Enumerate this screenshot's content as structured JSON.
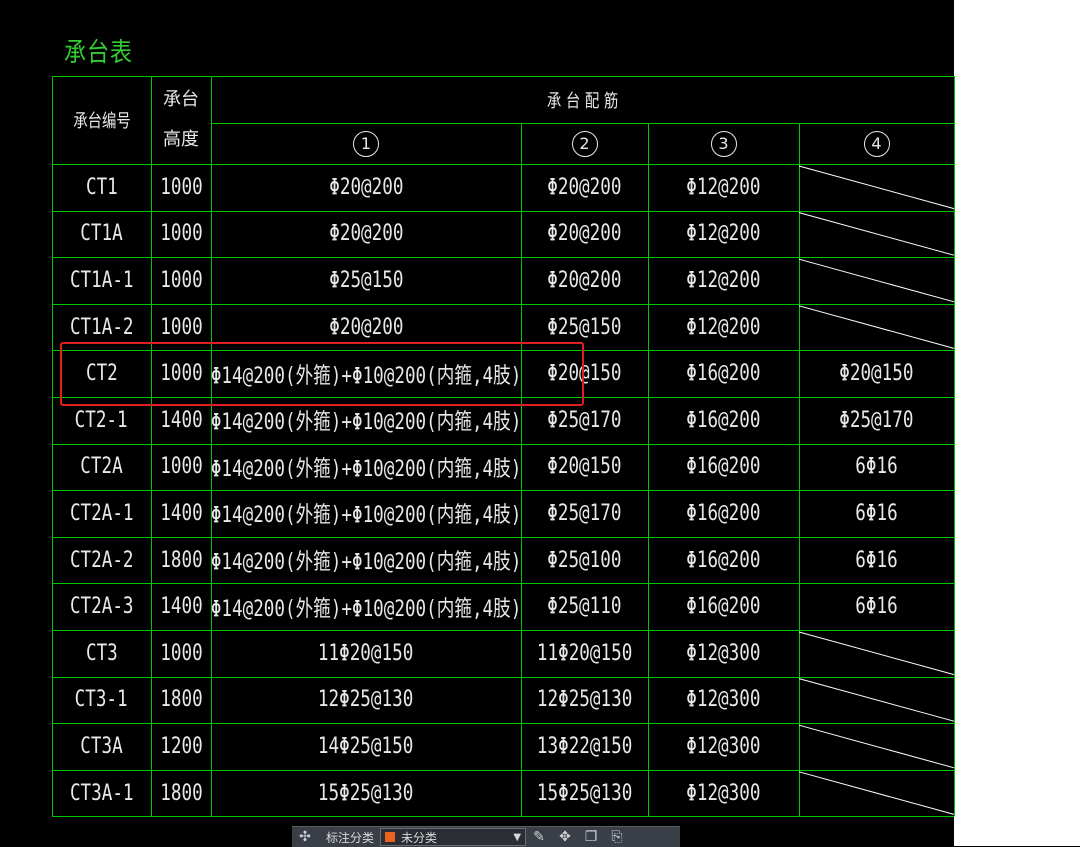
{
  "title": "承台表",
  "headers": {
    "id": "承台编号",
    "height_top": "承台",
    "height_bottom": "高度",
    "rebar": "承 台 配 筋",
    "cols": [
      "1",
      "2",
      "3",
      "4"
    ]
  },
  "rows": [
    {
      "id": "CT1",
      "h": "1000",
      "c1": "Φ20@200",
      "c2": "Φ20@200",
      "c3": "Φ12@200",
      "c4": ""
    },
    {
      "id": "CT1A",
      "h": "1000",
      "c1": "Φ20@200",
      "c2": "Φ20@200",
      "c3": "Φ12@200",
      "c4": ""
    },
    {
      "id": "CT1A-1",
      "h": "1000",
      "c1": "Φ25@150",
      "c2": "Φ20@200",
      "c3": "Φ12@200",
      "c4": ""
    },
    {
      "id": "CT1A-2",
      "h": "1000",
      "c1": "Φ20@200",
      "c2": "Φ25@150",
      "c3": "Φ12@200",
      "c4": ""
    },
    {
      "id": "CT2",
      "h": "1000",
      "c1": "Φ14@200(外箍)+Φ10@200(内箍,4肢)",
      "c2": "Φ20@150",
      "c3": "Φ16@200",
      "c4": "Φ20@150"
    },
    {
      "id": "CT2-1",
      "h": "1400",
      "c1": "Φ14@200(外箍)+Φ10@200(内箍,4肢)",
      "c2": "Φ25@170",
      "c3": "Φ16@200",
      "c4": "Φ25@170"
    },
    {
      "id": "CT2A",
      "h": "1000",
      "c1": "Φ14@200(外箍)+Φ10@200(内箍,4肢)",
      "c2": "Φ20@150",
      "c3": "Φ16@200",
      "c4": "6Φ16"
    },
    {
      "id": "CT2A-1",
      "h": "1400",
      "c1": "Φ14@200(外箍)+Φ10@200(内箍,4肢)",
      "c2": "Φ25@170",
      "c3": "Φ16@200",
      "c4": "6Φ16"
    },
    {
      "id": "CT2A-2",
      "h": "1800",
      "c1": "Φ14@200(外箍)+Φ10@200(内箍,4肢)",
      "c2": "Φ25@100",
      "c3": "Φ16@200",
      "c4": "6Φ16"
    },
    {
      "id": "CT2A-3",
      "h": "1400",
      "c1": "Φ14@200(外箍)+Φ10@200(内箍,4肢)",
      "c2": "Φ25@110",
      "c3": "Φ16@200",
      "c4": "6Φ16"
    },
    {
      "id": "CT3",
      "h": "1000",
      "c1": "11Φ20@150",
      "c2": "11Φ20@150",
      "c3": "Φ12@300",
      "c4": ""
    },
    {
      "id": "CT3-1",
      "h": "1800",
      "c1": "12Φ25@130",
      "c2": "12Φ25@130",
      "c3": "Φ12@300",
      "c4": ""
    },
    {
      "id": "CT3A",
      "h": "1200",
      "c1": "14Φ25@150",
      "c2": "13Φ22@150",
      "c3": "Φ12@300",
      "c4": ""
    },
    {
      "id": "CT3A-1",
      "h": "1800",
      "c1": "15Φ25@130",
      "c2": "15Φ25@130",
      "c3": "Φ12@300",
      "c4": ""
    }
  ],
  "toolbar": {
    "label": "标注分类",
    "select_value": "未分类",
    "select_color": "#e8641e"
  },
  "colors": {
    "grid": "#00c800",
    "title": "#33cc33",
    "text": "#e8e8e8",
    "highlight": "#e02020",
    "diagonal": "#ffffff"
  }
}
